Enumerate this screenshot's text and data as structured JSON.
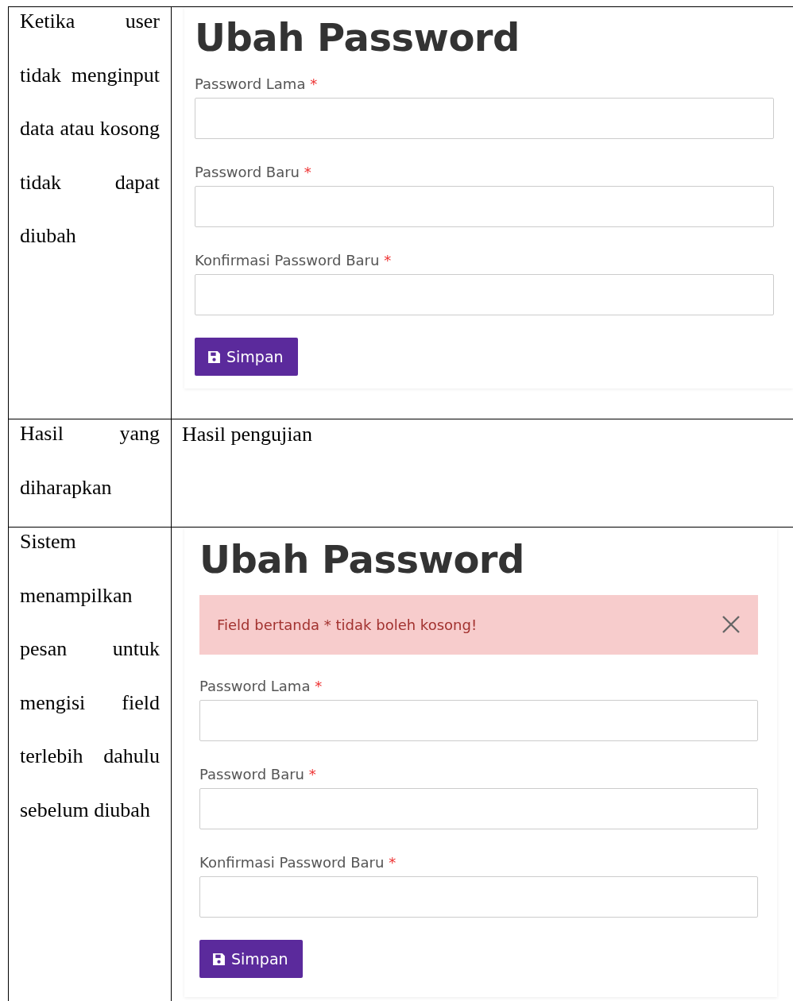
{
  "rows": [
    {
      "description": "Ketika user tidak menginput data atau kosong tidak dapat diubah",
      "content": {
        "kind": "screenshot",
        "title": "Ubah Password",
        "fields": [
          {
            "label": "Password Lama",
            "required_mark": "*"
          },
          {
            "label": "Password Baru",
            "required_mark": "*"
          },
          {
            "label": "Konfirmasi Password Baru",
            "required_mark": "*"
          }
        ],
        "button": "Simpan"
      }
    },
    {
      "description": "Hasil yang diharapkan",
      "content": {
        "kind": "text",
        "text": "Hasil pengujian"
      }
    },
    {
      "description": "Sistem menampilkan pesan untuk mengisi field terlebih dahulu sebelum diubah",
      "content": {
        "kind": "screenshot",
        "title": "Ubah Password",
        "alert": {
          "message": "Field bertanda * tidak boleh kosong!"
        },
        "fields": [
          {
            "label": "Password Lama",
            "required_mark": "*"
          },
          {
            "label": "Password Baru",
            "required_mark": "*"
          },
          {
            "label": "Konfirmasi Password Baru",
            "required_mark": "*"
          }
        ],
        "button": "Simpan"
      }
    }
  ]
}
